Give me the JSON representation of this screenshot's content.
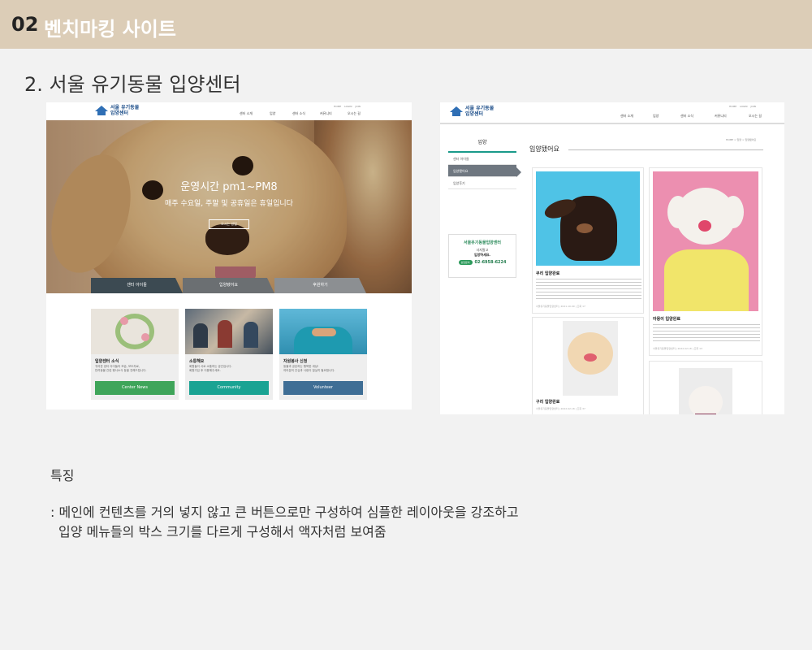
{
  "header": {
    "number": "02",
    "title": "벤치마킹 사이트"
  },
  "subtitle": "2. 서울 유기동물 입양센터",
  "site_main": {
    "logo": "서울 유기동물\n입양센터",
    "nav": [
      "센터 소개",
      "입양",
      "센터 소식",
      "커뮤니티",
      "오시는 길"
    ],
    "util_links": [
      "HOME",
      "LOGIN",
      "JOIN"
    ],
    "hero_title": "운영시간 pm1~PM8",
    "hero_subtitle": "매주 수요일, 주말 및 공휴일은 휴일입니다",
    "hero_button": "오시는 방법",
    "tabs": [
      "센터 아이들",
      "입양됐어요",
      "후원하기"
    ],
    "tab_colors": [
      "#3c4a52",
      "#6b6f72",
      "#8c8f92"
    ],
    "cards": [
      {
        "title": "입양센터 소식",
        "desc": "귀여운 센터 아이들의 모습, 보도자료,\n반려동물 관련 행사소식 등을 전해드립니다.",
        "button": "Center News",
        "color": "#3fa55a"
      },
      {
        "title": "소통해요",
        "desc": "회원들이 서로 소통하는 공간입니다.\n회원가입 후 이용해주세요.",
        "button": "Community",
        "color": "#1aa393"
      },
      {
        "title": "자원봉사 신청",
        "desc": "동물과 공존하는 행복한 세상!\n여러분의 관심과 사랑이 절실히 필요합니다.",
        "button": "Volunteer",
        "color": "#3f6e95"
      }
    ]
  },
  "site_sub": {
    "logo": "서울 유기동물\n입양센터",
    "nav": [
      "센터 소개",
      "입양",
      "센터 소식",
      "커뮤니티",
      "오시는 길"
    ],
    "util_links": [
      "HOME",
      "LOGIN",
      "JOIN"
    ],
    "side_title": "입양",
    "side_items": [
      "센터 아이들",
      "입양됐어요",
      "입양후기"
    ],
    "side_active": "입양됐어요",
    "box_title": "서울유기동물입양센터",
    "box_line1": "사지말고",
    "box_line2": "입양하세요.",
    "box_pill": "상담문의",
    "box_tel": "02-6958-6224",
    "content_title": "입양됐어요",
    "breadcrumb": "HOME > 입양 > 입양됐어요",
    "posts": [
      {
        "title": "쿠리 입양완료",
        "meta": "서울유기동물입양센터 | 2021.10.09 | 조회 17"
      },
      {
        "title": "아몽이 입양완료",
        "meta": "서울유기동물입양센터 | 2022.02.18 | 조회 13"
      },
      {
        "title": "구리 입양완료",
        "meta": "서울유기동물입양센터 | 2022.02.18 | 조회 37"
      }
    ]
  },
  "feature_label": "특징",
  "description_line1": ": 메인에 컨텐츠를 거의 넣지 않고 큰 버튼으로만 구성하여 심플한 레이아웃을 강조하고",
  "description_line2": "입양 메뉴들의 박스 크기를 다르게 구성해서 액자처럼 보여줌"
}
